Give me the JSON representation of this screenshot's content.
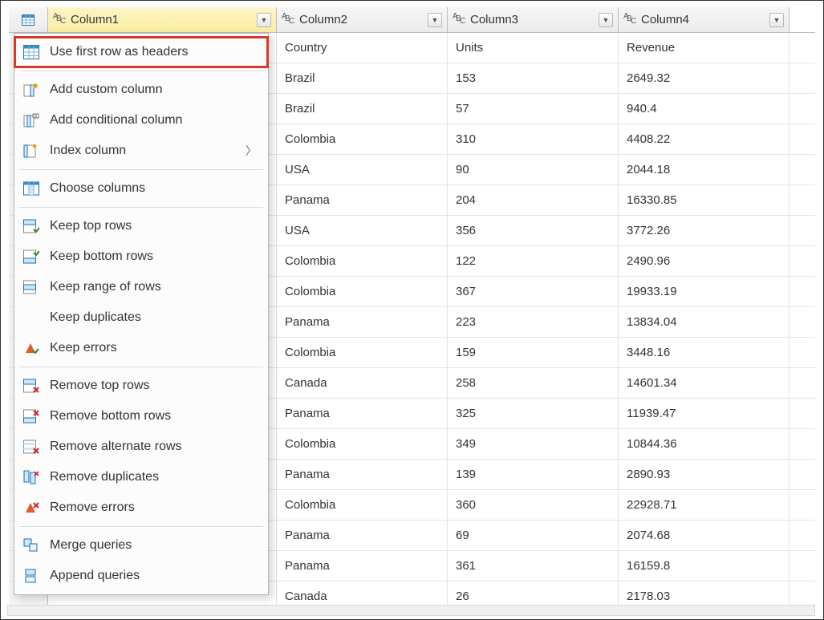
{
  "columns": {
    "col1": "Column1",
    "col2": "Column2",
    "col3": "Column3",
    "col4": "Column4"
  },
  "rows": [
    {
      "c2": "Country",
      "c3": "Units",
      "c4": "Revenue"
    },
    {
      "c2": "Brazil",
      "c3": "153",
      "c4": "2649.32"
    },
    {
      "c2": "Brazil",
      "c3": "57",
      "c4": "940.4"
    },
    {
      "c2": "Colombia",
      "c3": "310",
      "c4": "4408.22"
    },
    {
      "c2": "USA",
      "c3": "90",
      "c4": "2044.18"
    },
    {
      "c2": "Panama",
      "c3": "204",
      "c4": "16330.85"
    },
    {
      "c2": "USA",
      "c3": "356",
      "c4": "3772.26"
    },
    {
      "c2": "Colombia",
      "c3": "122",
      "c4": "2490.96"
    },
    {
      "c2": "Colombia",
      "c3": "367",
      "c4": "19933.19"
    },
    {
      "c2": "Panama",
      "c3": "223",
      "c4": "13834.04"
    },
    {
      "c2": "Colombia",
      "c3": "159",
      "c4": "3448.16"
    },
    {
      "c2": "Canada",
      "c3": "258",
      "c4": "14601.34"
    },
    {
      "c2": "Panama",
      "c3": "325",
      "c4": "11939.47"
    },
    {
      "c2": "Colombia",
      "c3": "349",
      "c4": "10844.36"
    },
    {
      "c2": "Panama",
      "c3": "139",
      "c4": "2890.93"
    },
    {
      "c2": "Colombia",
      "c3": "360",
      "c4": "22928.71"
    },
    {
      "c2": "Panama",
      "c3": "69",
      "c4": "2074.68"
    },
    {
      "c2": "Panama",
      "c3": "361",
      "c4": "16159.8"
    },
    {
      "c2": "Canada",
      "c3": "26",
      "c4": "2178.03"
    }
  ],
  "menu": {
    "use_first_row": "Use first row as headers",
    "add_custom": "Add custom column",
    "add_cond": "Add conditional column",
    "index_col": "Index column",
    "choose_cols": "Choose columns",
    "keep_top": "Keep top rows",
    "keep_bottom": "Keep bottom rows",
    "keep_range": "Keep range of rows",
    "keep_dup": "Keep duplicates",
    "keep_err": "Keep errors",
    "remove_top": "Remove top rows",
    "remove_bottom": "Remove bottom rows",
    "remove_alt": "Remove alternate rows",
    "remove_dup": "Remove duplicates",
    "remove_err": "Remove errors",
    "merge_q": "Merge queries",
    "append_q": "Append queries"
  }
}
